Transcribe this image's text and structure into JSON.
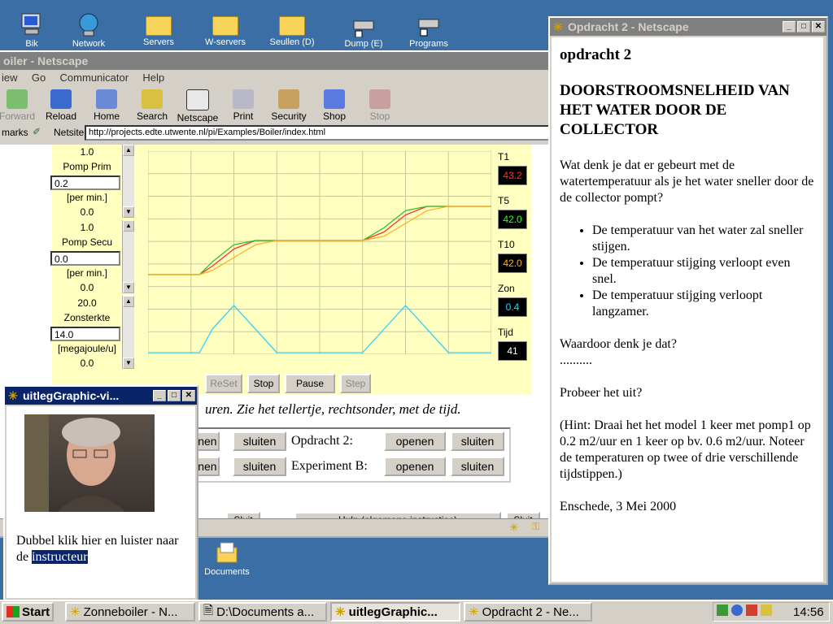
{
  "desktop": {
    "icons": [
      {
        "label": "Bik",
        "icon": "computer-icon"
      },
      {
        "label": "Network",
        "icon": "network-icon"
      },
      {
        "label": "Servers",
        "icon": "folder-icon"
      },
      {
        "label": "W-servers",
        "icon": "folder-icon"
      },
      {
        "label": "Seullen (D)",
        "icon": "folder-icon"
      },
      {
        "label": "Dump (E)",
        "icon": "drive-icon"
      },
      {
        "label": "Programs",
        "icon": "drive-icon"
      },
      {
        "label": "Documents",
        "icon": "documents-icon"
      }
    ]
  },
  "boiler": {
    "title": "oiler - Netscape",
    "menu": [
      "iew",
      "Go",
      "Communicator",
      "Help"
    ],
    "toolbar": [
      "Forward",
      "Reload",
      "Home",
      "Search",
      "Netscape",
      "Print",
      "Security",
      "Shop",
      "Stop"
    ],
    "bookmarks": "marks",
    "location_label": "Netsite:",
    "url": "http://projects.edte.utwente.nl/pi/Examples/Boiler/index.html",
    "controls": [
      {
        "max": "1.0",
        "name": "Pomp Prim",
        "value": "0.2",
        "unit": "[per min.]",
        "min": "0.0"
      },
      {
        "max": "1.0",
        "name": "Pomp Secu",
        "value": "0.0",
        "unit": "[per min.]",
        "min": "0.0"
      },
      {
        "max": "20.0",
        "name": "Zonsterkte",
        "value": "14.0",
        "unit": "[megajoule/u]",
        "min": "0.0"
      }
    ],
    "readouts": [
      {
        "label": "T1",
        "value": "43.2",
        "color": "#ff3030"
      },
      {
        "label": "T5",
        "value": "42.0",
        "color": "#30ff30"
      },
      {
        "label": "T10",
        "value": "42.0",
        "color": "#ffb020"
      },
      {
        "label": "Zon",
        "value": "0.4",
        "color": "#30d0ff"
      },
      {
        "label": "Tijd",
        "value": "41",
        "color": "#ffffff"
      }
    ],
    "sim_buttons": [
      "ReSet",
      "Stop",
      "Pause",
      "Step"
    ],
    "instruction": "uren. Zie het tellertje, rechtsonder, met de tijd.",
    "table": [
      {
        "open": "enen",
        "close": "sluiten",
        "label": "Opdracht 2:",
        "open2": "openen",
        "close2": "sluiten"
      },
      {
        "open": "enen",
        "close": "sluiten",
        "label": "Experiment B:",
        "open2": "openen",
        "close2": "sluiten"
      }
    ],
    "bottom_buttons": [
      "Sluit",
      "Hulp (algemene instructies)",
      "Sluit"
    ]
  },
  "opdracht": {
    "title": "Opdracht 2 - Netscape",
    "heading": "opdracht 2",
    "subheading": "DOORSTROOMSNELHEID VAN HET WATER DOOR DE COLLECTOR",
    "question": "Wat denk je dat er gebeurt met de watertemperatuur als je het water sneller door de de collector pompt?",
    "bullets": [
      "De temperatuur van het water zal sneller stijgen.",
      "De temperatuur stijging verloopt even snel.",
      "De temperatuur stijging verloopt langzamer."
    ],
    "why": "Waardoor denk je dat?",
    "dots": "..........",
    "try": "Probeer het uit?",
    "hint": "(Hint: Draai het het model 1 keer met pomp1 op 0.2 m2/uur en 1 keer op bv. 0.6 m2/uur. Noteer de temperaturen op twee of drie verschillende tijdstippen.)",
    "footer": "Enschede, 3 Mei 2000"
  },
  "uitleg": {
    "title": "uitlegGraphic-vi...",
    "text_before": "Dubbel klik hier en luister naar de ",
    "highlight": "instructeur"
  },
  "taskbar": {
    "start": "Start",
    "tasks": [
      "Zonneboiler - N...",
      "D:\\Documents a...",
      "uitlegGraphic...",
      "Opdracht 2 - Ne..."
    ],
    "clock": "14:56"
  },
  "chart_data": {
    "type": "line",
    "title": "",
    "x": [
      0,
      5,
      10,
      12,
      15,
      20,
      25,
      30,
      35,
      40,
      45,
      50,
      55,
      60,
      65,
      70,
      75,
      80
    ],
    "series": [
      {
        "color": "#ff3030",
        "values": [
          30,
          30,
          30,
          30,
          31,
          33,
          34,
          34,
          34,
          34,
          34,
          34,
          35,
          37,
          38,
          38,
          38,
          38
        ]
      },
      {
        "color": "#30c030",
        "values": [
          30,
          30,
          30,
          30,
          31.5,
          33.5,
          34,
          34,
          34,
          34,
          34,
          34,
          35.5,
          37.5,
          38,
          38,
          38,
          38
        ]
      },
      {
        "color": "#ffb020",
        "values": [
          30,
          30,
          30,
          30,
          30.5,
          32,
          33.5,
          34,
          34,
          34,
          34,
          34,
          34.5,
          36,
          37.5,
          38,
          38,
          38
        ]
      },
      {
        "color": "#30d0ff",
        "values": [
          0,
          0,
          0,
          0,
          10,
          20,
          10,
          0,
          0,
          0,
          0,
          0,
          10,
          20,
          10,
          0,
          0,
          0
        ]
      }
    ],
    "grid": true
  }
}
